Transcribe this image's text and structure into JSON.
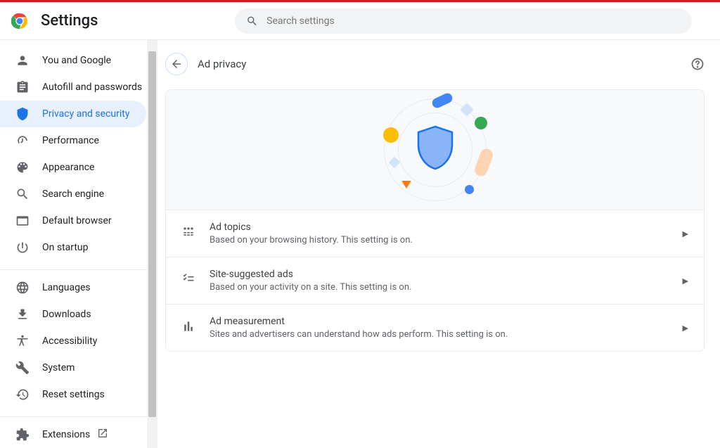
{
  "header": {
    "title": "Settings",
    "search_placeholder": "Search settings"
  },
  "sidebar": {
    "section1": [
      {
        "id": "you-and-google",
        "label": "You and Google"
      },
      {
        "id": "autofill",
        "label": "Autofill and passwords"
      },
      {
        "id": "privacy",
        "label": "Privacy and security",
        "selected": true
      },
      {
        "id": "performance",
        "label": "Performance"
      },
      {
        "id": "appearance",
        "label": "Appearance"
      },
      {
        "id": "search-engine",
        "label": "Search engine"
      },
      {
        "id": "default-browser",
        "label": "Default browser"
      },
      {
        "id": "on-startup",
        "label": "On startup"
      }
    ],
    "section2": [
      {
        "id": "languages",
        "label": "Languages"
      },
      {
        "id": "downloads",
        "label": "Downloads"
      },
      {
        "id": "accessibility",
        "label": "Accessibility"
      },
      {
        "id": "system",
        "label": "System"
      },
      {
        "id": "reset",
        "label": "Reset settings"
      }
    ],
    "section3": [
      {
        "id": "extensions",
        "label": "Extensions"
      }
    ]
  },
  "main": {
    "page_title": "Ad privacy",
    "rows": [
      {
        "title": "Ad topics",
        "sub": "Based on your browsing history. This setting is on."
      },
      {
        "title": "Site-suggested ads",
        "sub": "Based on your activity on a site. This setting is on."
      },
      {
        "title": "Ad measurement",
        "sub": "Sites and advertisers can understand how ads perform. This setting is on."
      }
    ]
  }
}
